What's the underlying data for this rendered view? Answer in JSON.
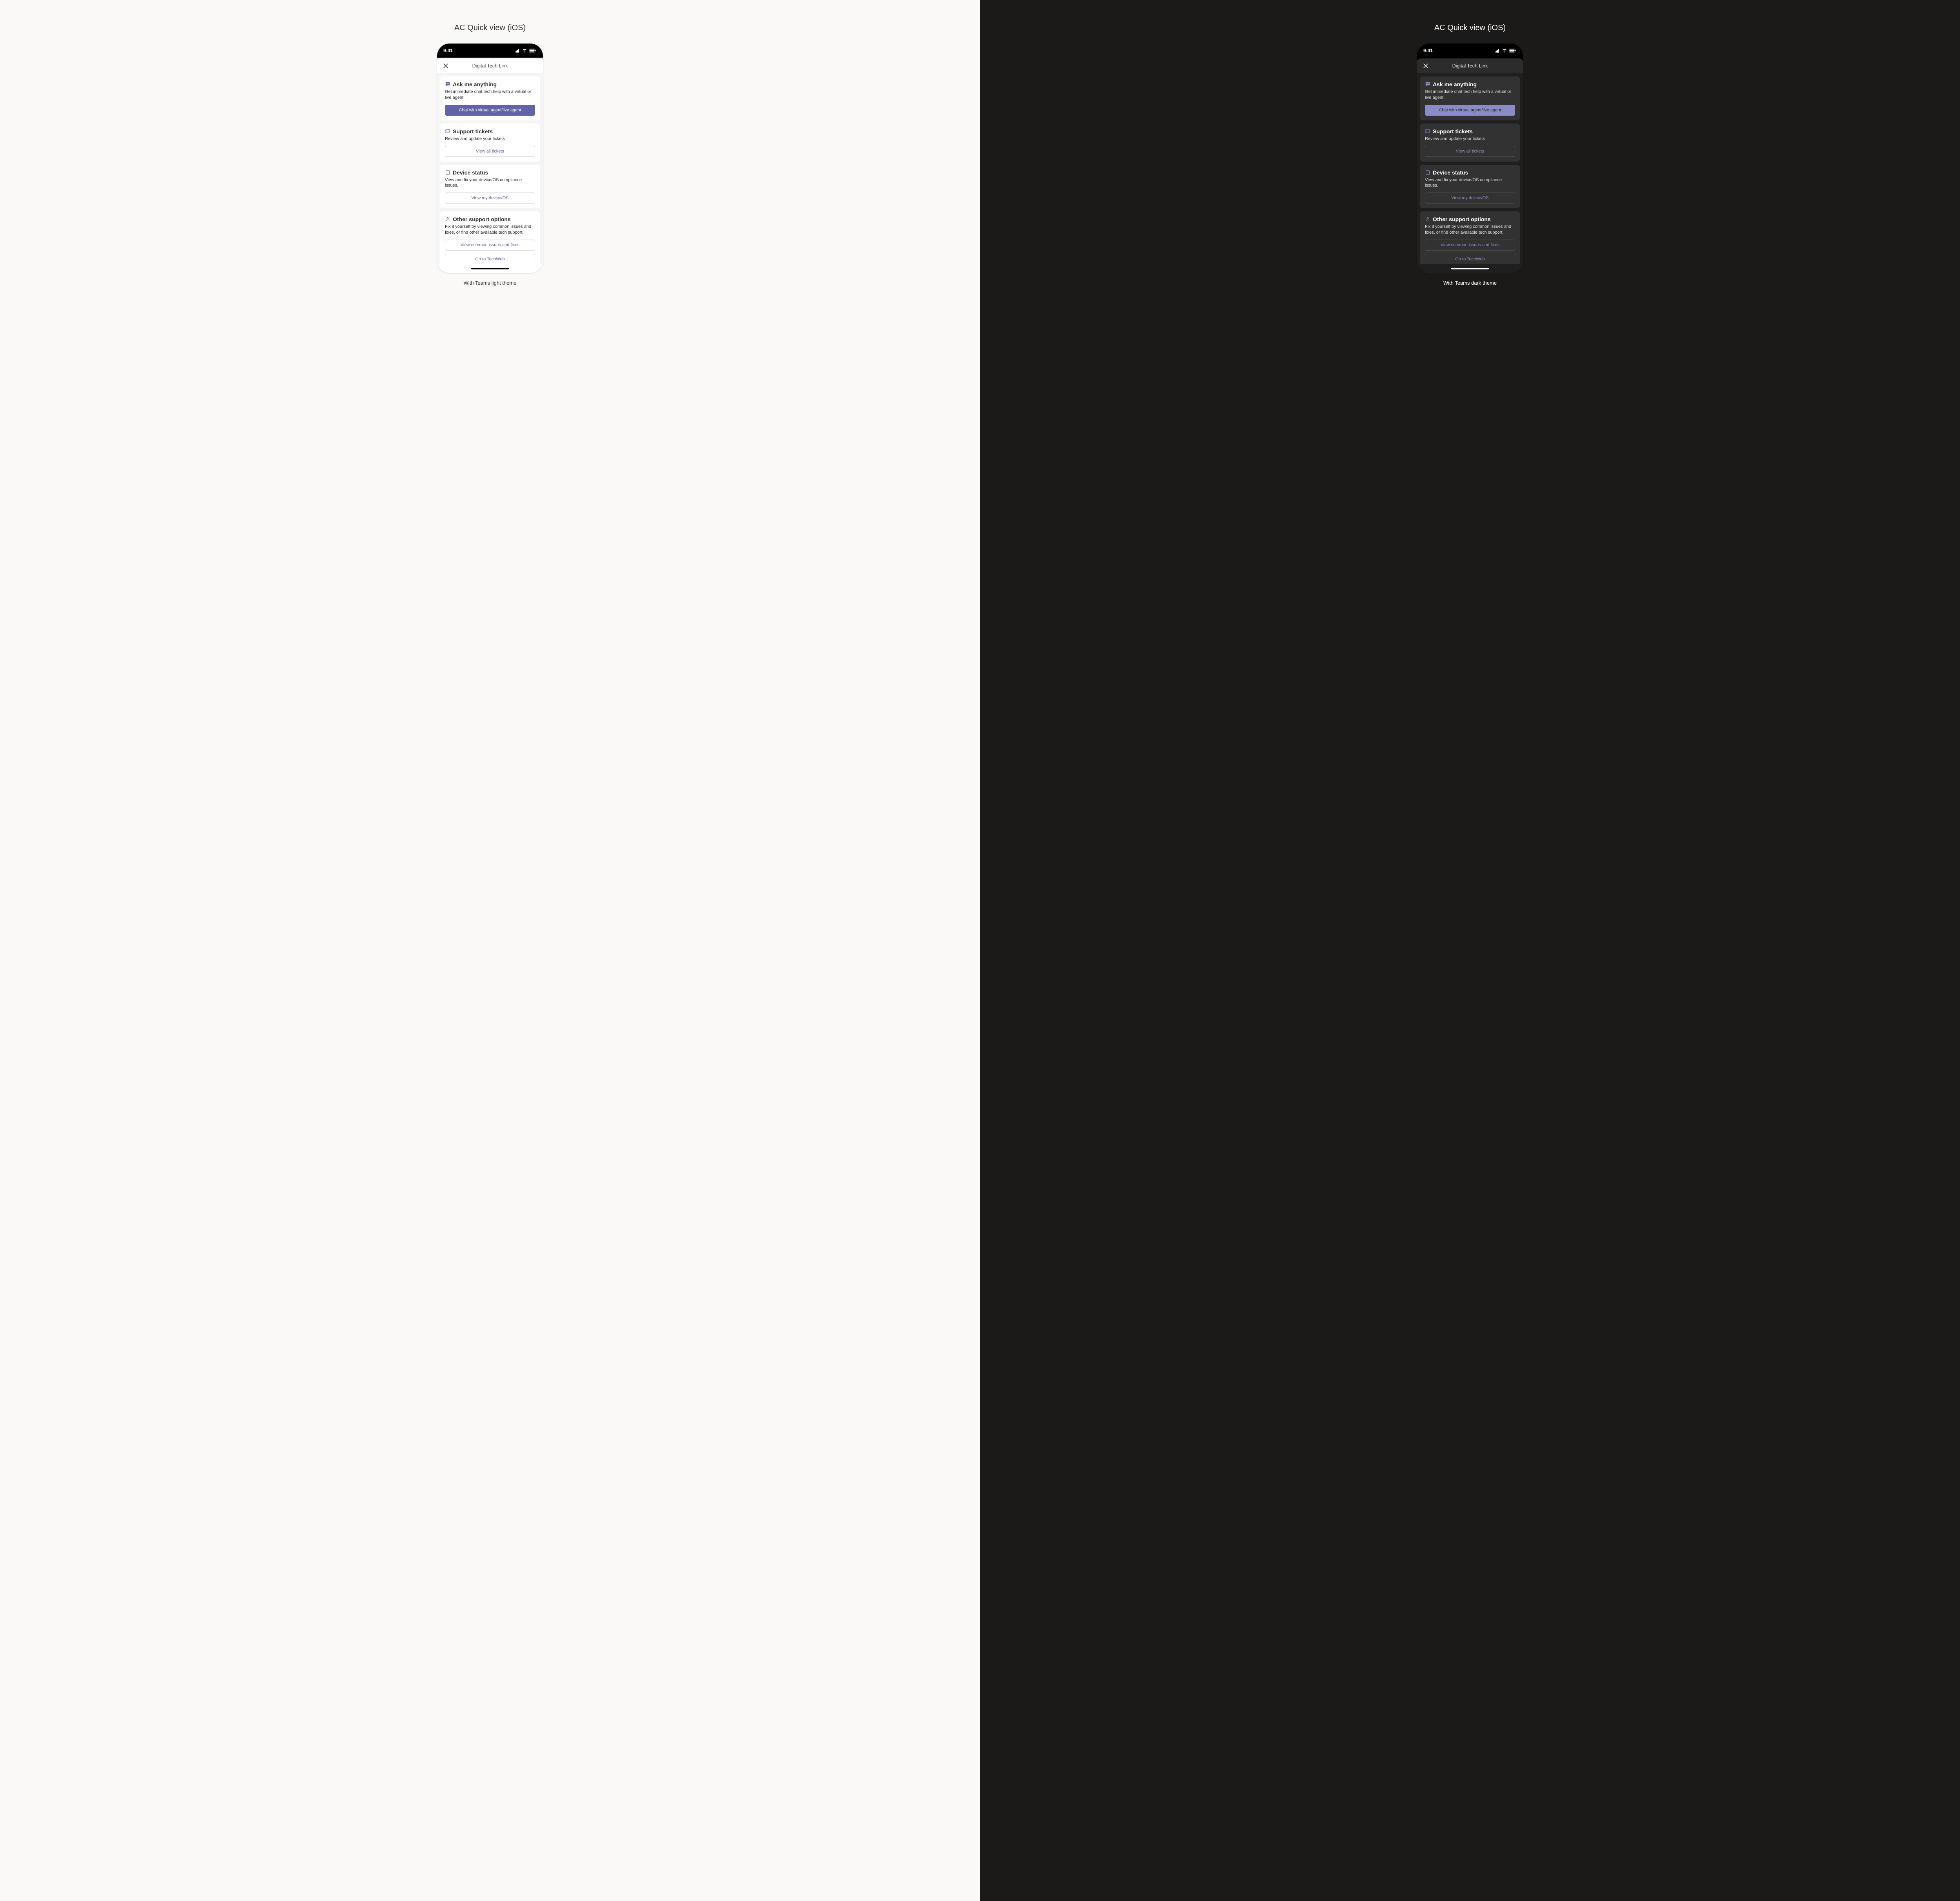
{
  "title": "AC Quick view (iOS)",
  "status_time": "9:41",
  "sheet_title": "Digital Tech Link",
  "cards": [
    {
      "icon": "chat-icon",
      "title": "Ask me anything",
      "desc": "Get immediate chat tech help with a virtual or live agent.",
      "buttons": [
        {
          "label": "Chat with virtual agent/live agent",
          "style": "primary",
          "name": "chat-agent-button"
        }
      ]
    },
    {
      "icon": "ticket-icon",
      "title": "Support tickets",
      "desc": "Review and update your tickets",
      "buttons": [
        {
          "label": "View all tickets",
          "style": "secondary",
          "name": "view-tickets-button"
        }
      ]
    },
    {
      "icon": "device-icon",
      "title": "Device status",
      "desc": "View and fix your device/OS compliance issues.",
      "buttons": [
        {
          "label": "View my device/OS",
          "style": "secondary",
          "name": "view-device-button"
        }
      ]
    },
    {
      "icon": "support-icon",
      "title": "Other support options",
      "desc": "Fix it yourself by viewing common issues and fixes, or find other available tech support.",
      "buttons": [
        {
          "label": "View common issues and fixes",
          "style": "secondary",
          "name": "view-issues-button"
        },
        {
          "label": "Go to TechWeb",
          "style": "secondary",
          "name": "techweb-button"
        }
      ]
    }
  ],
  "captions": {
    "light": "With Teams light theme",
    "dark": "With Teams dark theme"
  }
}
